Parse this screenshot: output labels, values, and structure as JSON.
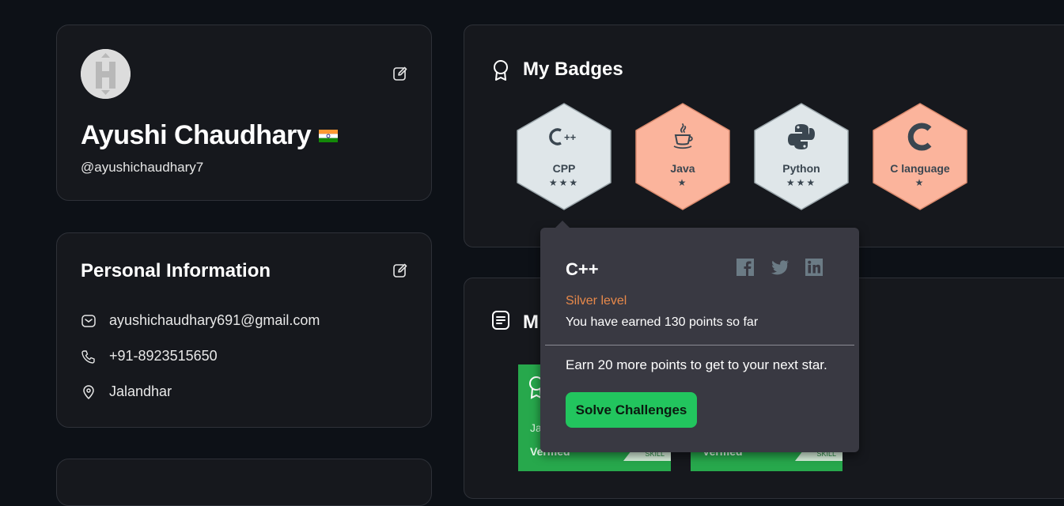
{
  "profile": {
    "name": "Ayushi Chaudhary",
    "username": "@ayushichaudhary7"
  },
  "personal_info": {
    "title": "Personal Information",
    "email": "ayushichaudhary691@gmail.com",
    "phone": "+91-8923515650",
    "location": "Jalandhar"
  },
  "badges": {
    "title": "My Badges",
    "items": [
      {
        "label": "CPP",
        "stars": "★★★",
        "icon": "cpp-icon",
        "level": "silver"
      },
      {
        "label": "Java",
        "stars": "★",
        "icon": "java-icon",
        "level": "bronze"
      },
      {
        "label": "Python",
        "stars": "★★★",
        "icon": "python-icon",
        "level": "silver"
      },
      {
        "label": "C language",
        "stars": "★",
        "icon": "c-icon",
        "level": "bronze"
      }
    ]
  },
  "certificates": {
    "title_visible": "M",
    "tile_texts": [
      "Ja",
      "Verified",
      "SKILL",
      "Verified",
      "SKILL"
    ]
  },
  "tooltip": {
    "title": "C++",
    "level": "Silver level",
    "points_text": "You have earned 130 points so far",
    "next_text": "Earn 20 more points to get to your next star.",
    "button_label": "Solve Challenges",
    "socials": [
      "facebook-icon",
      "twitter-icon",
      "linkedin-icon"
    ]
  },
  "colors": {
    "background": "#0d1117",
    "card": "#16181d",
    "silver_badge": "#dfe6e9",
    "bronze_badge": "#fbb49c",
    "accent_green": "#22c55e",
    "level_orange": "#e8894a"
  }
}
